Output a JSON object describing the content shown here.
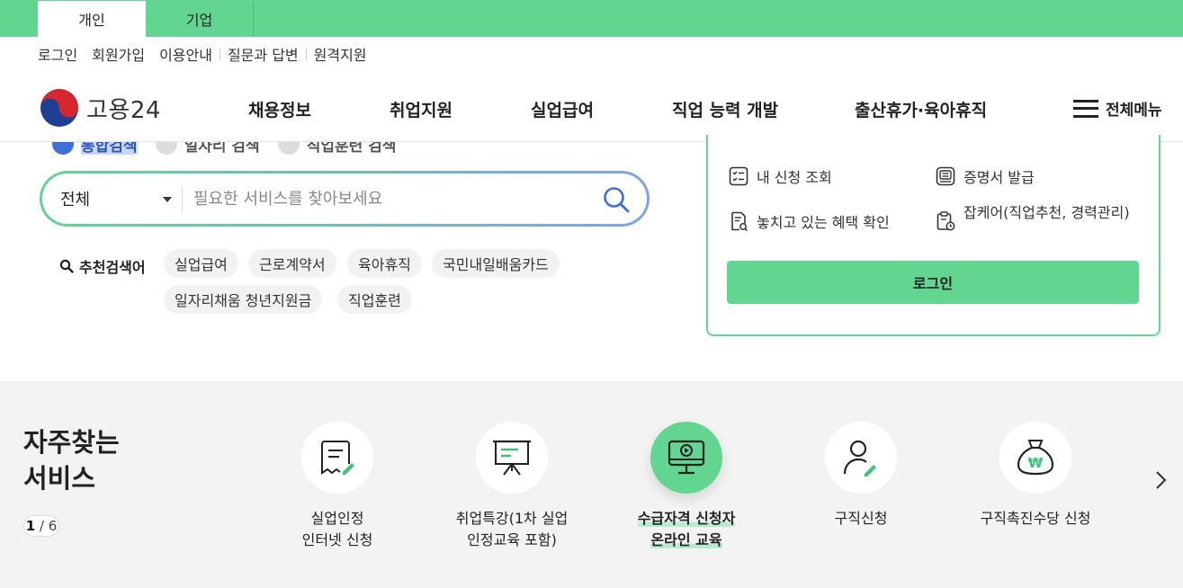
{
  "tabs": [
    {
      "label": "개인",
      "active": true
    },
    {
      "label": "기업",
      "active": false
    }
  ],
  "util_links": [
    "로그인",
    "회원가입",
    "이용안내",
    "질문과 답변",
    "원격지원"
  ],
  "logo": {
    "text": "고용24"
  },
  "gnb": [
    "채용정보",
    "취업지원",
    "실업급여",
    "직업 능력 개발",
    "출산휴가·육아휴직"
  ],
  "all_menu": "전체메뉴",
  "search_types": [
    {
      "label": "통합검색",
      "active": true
    },
    {
      "label": "일자리 검색",
      "active": false
    },
    {
      "label": "직업훈련 검색",
      "active": false
    }
  ],
  "search": {
    "select_value": "전체",
    "placeholder": "필요한 서비스를 찾아보세요"
  },
  "recommend": {
    "label": "추천검색어",
    "chips": [
      "실업급여",
      "근로계약서",
      "육아휴직",
      "국민내일배움카드",
      "일자리채움 청년지원금",
      "직업훈련"
    ]
  },
  "login_panel": {
    "items": [
      "내 신청 조회",
      "증명서 발급",
      "놓치고 있는 혜택 확인",
      "잡케어(직업추천, 경력관리)"
    ],
    "login_button": "로그인"
  },
  "frequent": {
    "title_line1": "자주찾는",
    "title_line2": "서비스",
    "pager_current": "1",
    "pager_total": "6",
    "services": [
      {
        "line1": "실업인정",
        "line2": "인터넷 신청",
        "icon": "document-pen-icon",
        "active": false
      },
      {
        "line1": "취업특강(1차 실업",
        "line2": "인정교육 포함)",
        "icon": "presentation-board-icon",
        "active": false
      },
      {
        "line1": "수급자격 신청자",
        "line2": "온라인 교육",
        "icon": "monitor-play-icon",
        "active": true
      },
      {
        "line1": "구직신청",
        "line2": "",
        "icon": "person-pen-icon",
        "active": false
      },
      {
        "line1": "구직촉진수당 신청",
        "line2": "",
        "icon": "money-bag-icon",
        "active": false
      }
    ]
  },
  "colors": {
    "brand_green": "#62d591",
    "accent_blue": "#3f6fd8",
    "chip_bg": "#f1f2f4",
    "section_bg": "#f3f3f3"
  }
}
